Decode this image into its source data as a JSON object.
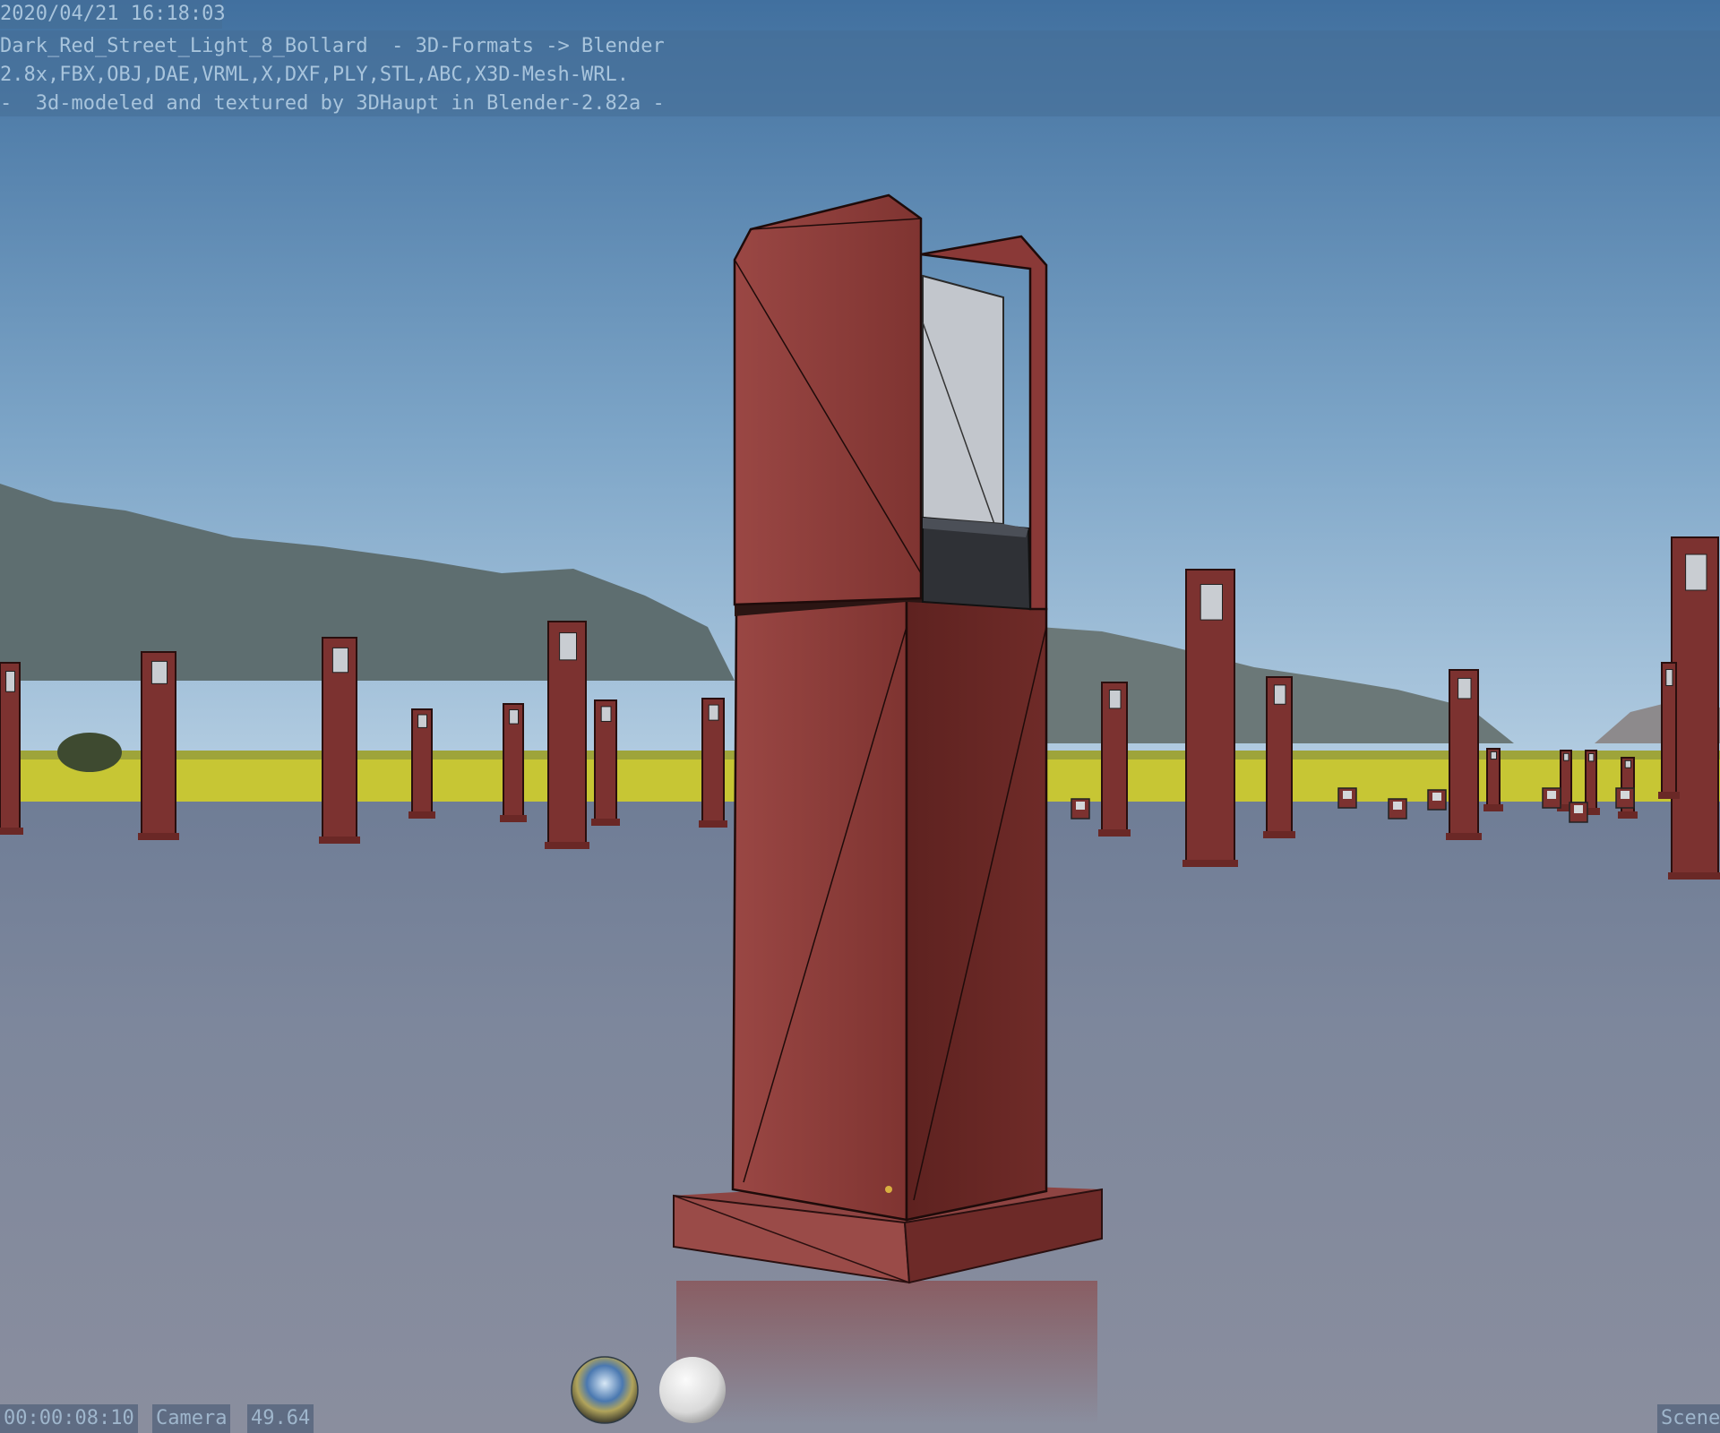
{
  "render_stamp": {
    "date": "2020/04/21 16:18:03",
    "line1": "Dark_Red_Street_Light_8_Bollard  - 3D-Formats -> Blender",
    "line2": "2.8x,FBX,OBJ,DAE,VRML,X,DXF,PLY,STL,ABC,X3D-Mesh-WRL.",
    "line3": "-  3d-modeled and textured by 3DHaupt in Blender-2.82a -"
  },
  "bottom_bar": {
    "frame_time": "00:00:08:10",
    "camera": "Camera",
    "focal": "49.64",
    "scene": "Scene"
  },
  "colors": {
    "sky_top": "#3f6f9f",
    "sky_horizon": "#a9c6df",
    "ground": "#7c879c",
    "bollard_red": "#8a3a36",
    "field_yellow": "#c9c832",
    "mountain": "#5f6f72"
  },
  "icons": {
    "hdri_ball": "hdri-sphere-icon",
    "material_ball": "matcap-sphere-icon"
  }
}
